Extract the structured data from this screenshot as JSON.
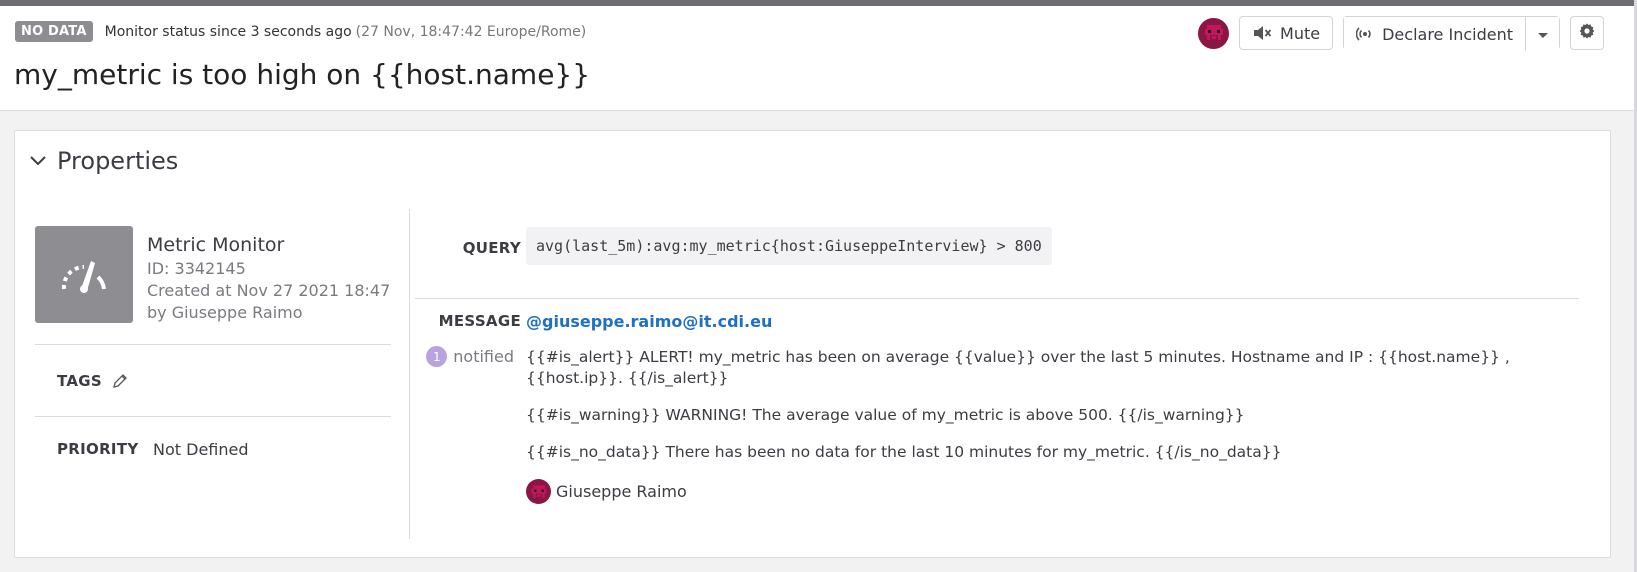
{
  "header": {
    "badge": "NO DATA",
    "status_text": "Monitor status since 3 seconds ago",
    "status_sub": "(27 Nov, 18:47:42 Europe/Rome)",
    "title": "my_metric is too high on {{host.name}}"
  },
  "actions": {
    "mute_label": "Mute",
    "declare_label": "Declare Incident"
  },
  "properties": {
    "section_title": "Properties",
    "monitor_type": "Metric Monitor",
    "monitor_id": "ID: 3342145",
    "created_at": "Created at Nov 27 2021 18:47",
    "created_by": "by Giuseppe Raimo",
    "tags_label": "TAGS",
    "priority_label": "PRIORITY",
    "priority_value": "Not Defined"
  },
  "query": {
    "label": "QUERY",
    "value": "avg(last_5m):avg:my_metric{host:GiuseppeInterview} > 800"
  },
  "message": {
    "label": "MESSAGE",
    "notified_count": "1",
    "notified_label": "notified",
    "mention": "@giuseppe.raimo@it.cdi.eu",
    "alert": "{{#is_alert}} ALERT! my_metric has been on average {{value}} over the last 5 minutes. Hostname and IP : {{host.name}} , {{host.ip}}. {{/is_alert}}",
    "warning": "{{#is_warning}} WARNING! The average value of my_metric is above 500. {{/is_warning}}",
    "no_data": "{{#is_no_data}} There has been no data for the last 10 minutes for my_metric. {{/is_no_data}}",
    "author": "Giuseppe Raimo"
  },
  "colors": {
    "badge": "#8d8d92",
    "mention_link": "#1f6fc5",
    "avatar": "#8b1544",
    "notified_count": "#b9a3dd"
  }
}
